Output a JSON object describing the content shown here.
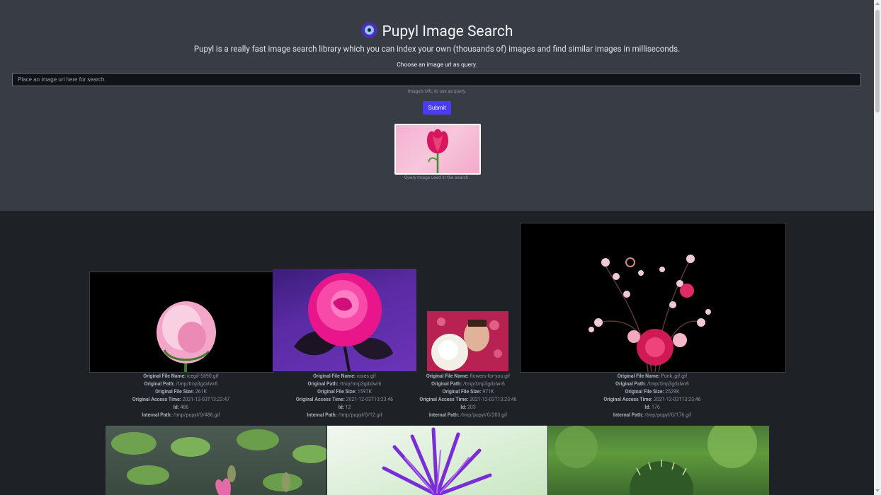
{
  "header": {
    "title": "Pupyl Image Search",
    "subtitle": "Pupyl is a really fast image search library which you can index your own (thousands of) images and find similar images in milliseconds.",
    "choose_label": "Choose an image url as query.",
    "logo_icon": "eye-icon"
  },
  "search": {
    "placeholder": "Place an image url here for search.",
    "value": "",
    "hint": "Image's URL to use as query.",
    "submit_label": "Submit"
  },
  "query": {
    "caption": "Query image used in the search."
  },
  "labels": {
    "file_name": "Original File Name",
    "path": "Original Path",
    "file_size": "Original File Size",
    "access_time": "Original Access Time",
    "id": "Id",
    "internal_path": "Internal Path"
  },
  "results": [
    {
      "file_name": "icegif-5690.gif",
      "path": "/tmp/tmp3gdxlwr6",
      "file_size": "261K",
      "access_time": "2021-12-03T13:23:47",
      "id": "486",
      "internal_path": "/tmp/pupyl/0/486.gif"
    },
    {
      "file_name": "roses.gif",
      "path": "/tmp/tmp3gdxlwr6",
      "file_size": "1597K",
      "access_time": "2021-12-03T13:23:46",
      "id": "12",
      "internal_path": "/tmp/pupyl/0/12.gif"
    },
    {
      "file_name": "flowers-for-you.gif",
      "path": "/tmp/tmp3gdxlwr6",
      "file_size": "971K",
      "access_time": "2021-12-03T13:23:46",
      "id": "203",
      "internal_path": "/tmp/pupyl/0/203.gif"
    },
    {
      "file_name": "Punk_gif.gif",
      "path": "/tmp/tmp3gdxlwr6",
      "file_size": "2529K",
      "access_time": "2021-12-03T13:23:46",
      "id": "176",
      "internal_path": "/tmp/pupyl/0/176.gif"
    }
  ],
  "colors": {
    "header_bg": "#373c45",
    "page_bg": "#1e2227",
    "accent": "#4a3cf3"
  }
}
